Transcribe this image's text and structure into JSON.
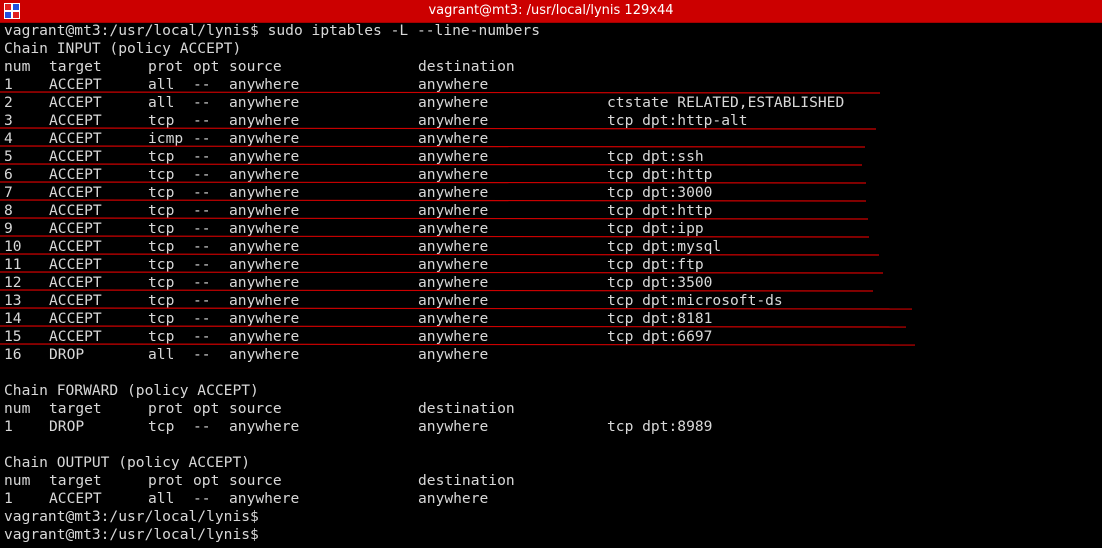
{
  "window": {
    "title": "vagrant@mt3: /usr/local/lynis 129x44"
  },
  "colors": {
    "titlebar": "#cc0000",
    "background": "#000000",
    "text": "#d8d8d8",
    "annotation": "#cc0000"
  },
  "terminal": {
    "prompt": "vagrant@mt3:/usr/local/lynis$",
    "command": "sudo iptables -L --line-numbers",
    "columns": {
      "num": "num",
      "target": "target",
      "prot": "prot",
      "opt": "opt",
      "source": "source",
      "destination": "destination"
    },
    "chains": [
      {
        "header": "Chain INPUT (policy ACCEPT)",
        "rules": [
          {
            "num": "1",
            "target": "ACCEPT",
            "prot": "all",
            "opt": "--",
            "source": "anywhere",
            "destination": "anywhere",
            "extra": ""
          },
          {
            "num": "2",
            "target": "ACCEPT",
            "prot": "all",
            "opt": "--",
            "source": "anywhere",
            "destination": "anywhere",
            "extra": "ctstate RELATED,ESTABLISHED"
          },
          {
            "num": "3",
            "target": "ACCEPT",
            "prot": "tcp",
            "opt": "--",
            "source": "anywhere",
            "destination": "anywhere",
            "extra": "tcp dpt:http-alt"
          },
          {
            "num": "4",
            "target": "ACCEPT",
            "prot": "icmp",
            "opt": "--",
            "source": "anywhere",
            "destination": "anywhere",
            "extra": ""
          },
          {
            "num": "5",
            "target": "ACCEPT",
            "prot": "tcp",
            "opt": "--",
            "source": "anywhere",
            "destination": "anywhere",
            "extra": "tcp dpt:ssh"
          },
          {
            "num": "6",
            "target": "ACCEPT",
            "prot": "tcp",
            "opt": "--",
            "source": "anywhere",
            "destination": "anywhere",
            "extra": "tcp dpt:http"
          },
          {
            "num": "7",
            "target": "ACCEPT",
            "prot": "tcp",
            "opt": "--",
            "source": "anywhere",
            "destination": "anywhere",
            "extra": "tcp dpt:3000"
          },
          {
            "num": "8",
            "target": "ACCEPT",
            "prot": "tcp",
            "opt": "--",
            "source": "anywhere",
            "destination": "anywhere",
            "extra": "tcp dpt:http"
          },
          {
            "num": "9",
            "target": "ACCEPT",
            "prot": "tcp",
            "opt": "--",
            "source": "anywhere",
            "destination": "anywhere",
            "extra": "tcp dpt:ipp"
          },
          {
            "num": "10",
            "target": "ACCEPT",
            "prot": "tcp",
            "opt": "--",
            "source": "anywhere",
            "destination": "anywhere",
            "extra": "tcp dpt:mysql"
          },
          {
            "num": "11",
            "target": "ACCEPT",
            "prot": "tcp",
            "opt": "--",
            "source": "anywhere",
            "destination": "anywhere",
            "extra": "tcp dpt:ftp"
          },
          {
            "num": "12",
            "target": "ACCEPT",
            "prot": "tcp",
            "opt": "--",
            "source": "anywhere",
            "destination": "anywhere",
            "extra": "tcp dpt:3500"
          },
          {
            "num": "13",
            "target": "ACCEPT",
            "prot": "tcp",
            "opt": "--",
            "source": "anywhere",
            "destination": "anywhere",
            "extra": "tcp dpt:microsoft-ds"
          },
          {
            "num": "14",
            "target": "ACCEPT",
            "prot": "tcp",
            "opt": "--",
            "source": "anywhere",
            "destination": "anywhere",
            "extra": "tcp dpt:8181"
          },
          {
            "num": "15",
            "target": "ACCEPT",
            "prot": "tcp",
            "opt": "--",
            "source": "anywhere",
            "destination": "anywhere",
            "extra": "tcp dpt:6697"
          },
          {
            "num": "16",
            "target": "DROP",
            "prot": "all",
            "opt": "--",
            "source": "anywhere",
            "destination": "anywhere",
            "extra": ""
          }
        ]
      },
      {
        "header": "Chain FORWARD (policy ACCEPT)",
        "rules": [
          {
            "num": "1",
            "target": "DROP",
            "prot": "tcp",
            "opt": "--",
            "source": "anywhere",
            "destination": "anywhere",
            "extra": "tcp dpt:8989"
          }
        ]
      },
      {
        "header": "Chain OUTPUT (policy ACCEPT)",
        "rules": [
          {
            "num": "1",
            "target": "ACCEPT",
            "prot": "all",
            "opt": "--",
            "source": "anywhere",
            "destination": "anywhere",
            "extra": ""
          }
        ]
      }
    ],
    "trailing_prompts": [
      "vagrant@mt3:/usr/local/lynis$",
      "vagrant@mt3:/usr/local/lynis$"
    ],
    "partial_last_line": "vagrant@mt3:/usr/local/lynis$",
    "underlined_input_rules": [
      "1",
      "3",
      "4",
      "5",
      "6",
      "7",
      "8",
      "9",
      "10",
      "11",
      "12",
      "13",
      "14",
      "15"
    ]
  }
}
